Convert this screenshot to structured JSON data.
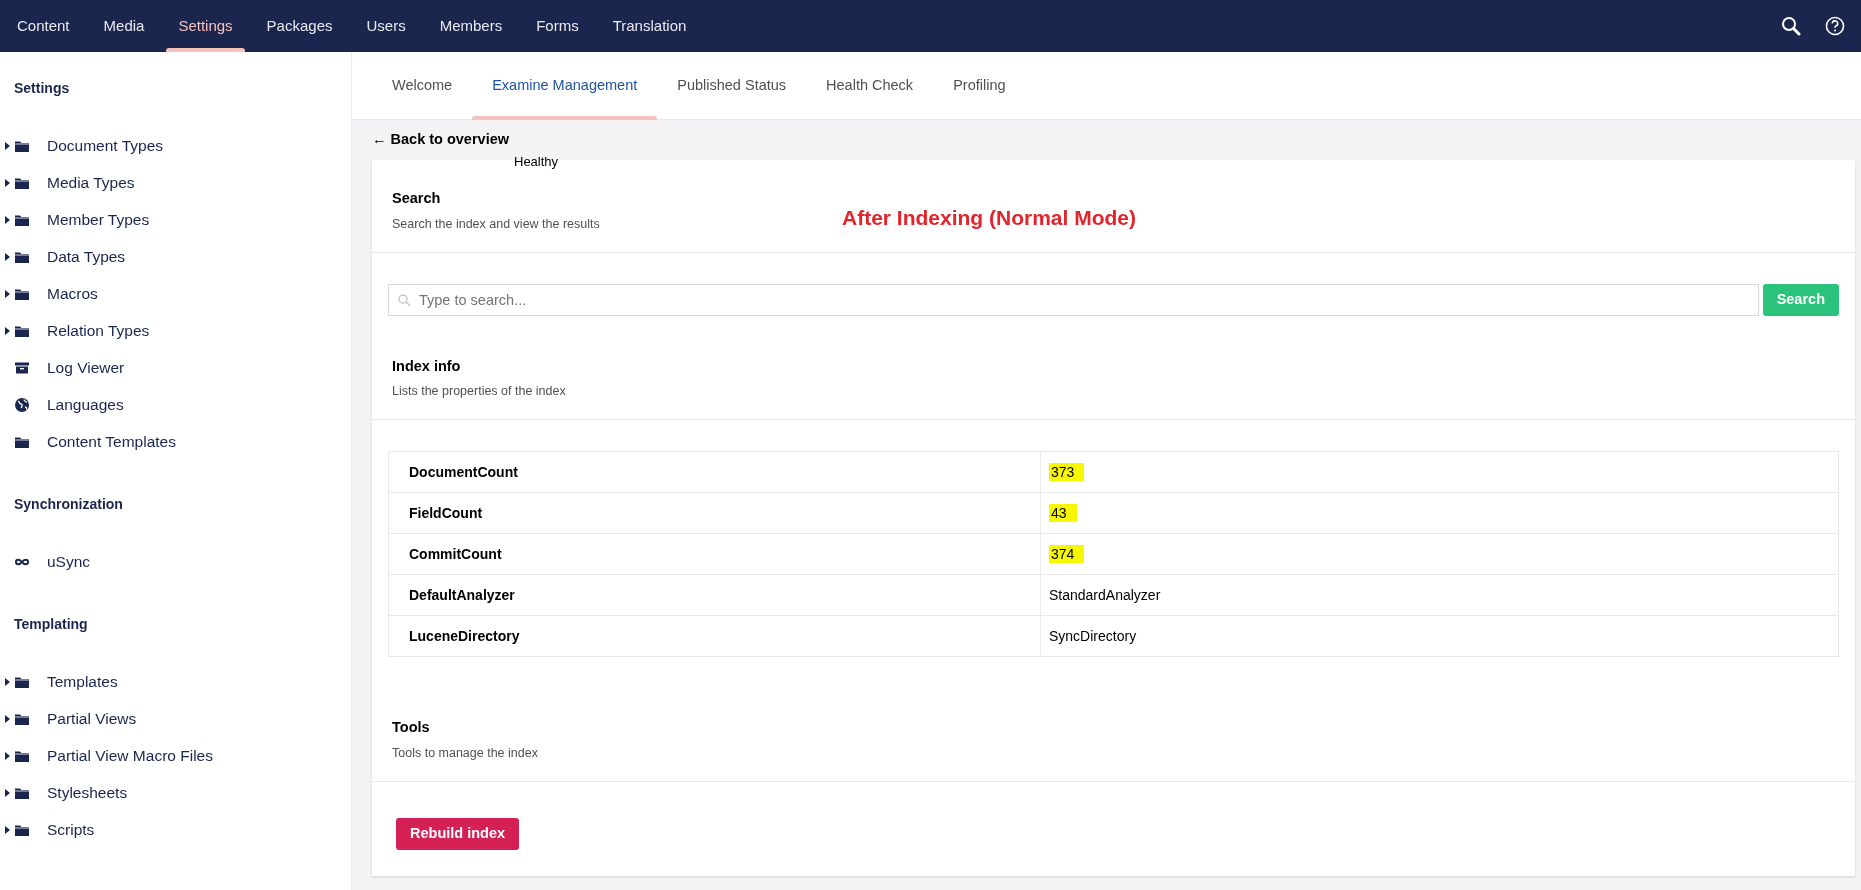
{
  "top_nav": {
    "items": [
      {
        "label": "Content",
        "selected": false
      },
      {
        "label": "Media",
        "selected": false
      },
      {
        "label": "Settings",
        "selected": true
      },
      {
        "label": "Packages",
        "selected": false
      },
      {
        "label": "Users",
        "selected": false
      },
      {
        "label": "Members",
        "selected": false
      },
      {
        "label": "Forms",
        "selected": false
      },
      {
        "label": "Translation",
        "selected": false
      }
    ]
  },
  "sidebar": {
    "sections": [
      {
        "title": "Settings",
        "items": [
          {
            "label": "Document Types",
            "kind": "folder",
            "expandable": true
          },
          {
            "label": "Media Types",
            "kind": "folder",
            "expandable": true
          },
          {
            "label": "Member Types",
            "kind": "folder",
            "expandable": true
          },
          {
            "label": "Data Types",
            "kind": "folder",
            "expandable": true
          },
          {
            "label": "Macros",
            "kind": "folder",
            "expandable": true
          },
          {
            "label": "Relation Types",
            "kind": "folder",
            "expandable": true
          },
          {
            "label": "Log Viewer",
            "kind": "archive",
            "expandable": false
          },
          {
            "label": "Languages",
            "kind": "globe",
            "expandable": false
          },
          {
            "label": "Content Templates",
            "kind": "folder",
            "expandable": false
          }
        ]
      },
      {
        "title": "Synchronization",
        "items": [
          {
            "label": "uSync",
            "kind": "infinity",
            "expandable": false
          }
        ]
      },
      {
        "title": "Templating",
        "items": [
          {
            "label": "Templates",
            "kind": "folder",
            "expandable": true
          },
          {
            "label": "Partial Views",
            "kind": "folder",
            "expandable": true
          },
          {
            "label": "Partial View Macro Files",
            "kind": "folder",
            "expandable": true
          },
          {
            "label": "Stylesheets",
            "kind": "folder",
            "expandable": true
          },
          {
            "label": "Scripts",
            "kind": "folder",
            "expandable": true
          }
        ]
      }
    ]
  },
  "tabs": [
    {
      "label": "Welcome",
      "selected": false
    },
    {
      "label": "Examine Management",
      "selected": true
    },
    {
      "label": "Published Status",
      "selected": false
    },
    {
      "label": "Health Check",
      "selected": false
    },
    {
      "label": "Profiling",
      "selected": false
    }
  ],
  "back_link": "← Back to overview",
  "status_value": "Healthy",
  "annotation": "After Indexing (Normal Mode)",
  "search_section": {
    "title": "Search",
    "subtitle": "Search the index and view the results",
    "placeholder": "Type to search...",
    "button": "Search"
  },
  "index_info": {
    "title": "Index info",
    "subtitle": "Lists the properties of the index",
    "rows": [
      {
        "name": "DocumentCount",
        "value": "373",
        "highlighted": true
      },
      {
        "name": "FieldCount",
        "value": "43",
        "highlighted": true
      },
      {
        "name": "CommitCount",
        "value": "374",
        "highlighted": true
      },
      {
        "name": "DefaultAnalyzer",
        "value": "StandardAnalyzer",
        "highlighted": false
      },
      {
        "name": "LuceneDirectory",
        "value": "SyncDirectory",
        "highlighted": false
      }
    ]
  },
  "tools": {
    "title": "Tools",
    "subtitle": "Tools to manage the index",
    "button": "Rebuild index"
  }
}
